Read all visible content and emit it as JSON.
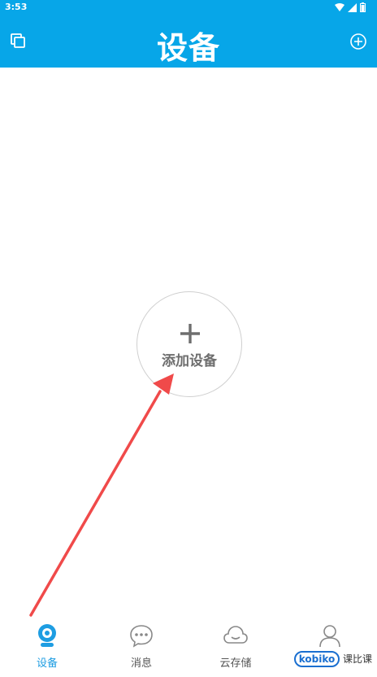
{
  "status_bar": {
    "time": "3:53"
  },
  "header": {
    "title": "设备",
    "left_icon": "copy-icon",
    "right_icon": "add-circle-icon",
    "background": "#07a6e8"
  },
  "main": {
    "add_device_label": "添加设备",
    "add_icon": "plus-icon"
  },
  "tabs": [
    {
      "label": "设备",
      "icon": "camera-icon",
      "active": true
    },
    {
      "label": "消息",
      "icon": "chat-icon",
      "active": false
    },
    {
      "label": "云存储",
      "icon": "cloud-icon",
      "active": false
    },
    {
      "label": "",
      "icon": "user-icon",
      "active": false
    }
  ],
  "watermark": {
    "logo_text": "kobiko",
    "text": "课比课"
  },
  "colors": {
    "accent": "#1e9de2",
    "arrow": "#f04a4a"
  }
}
